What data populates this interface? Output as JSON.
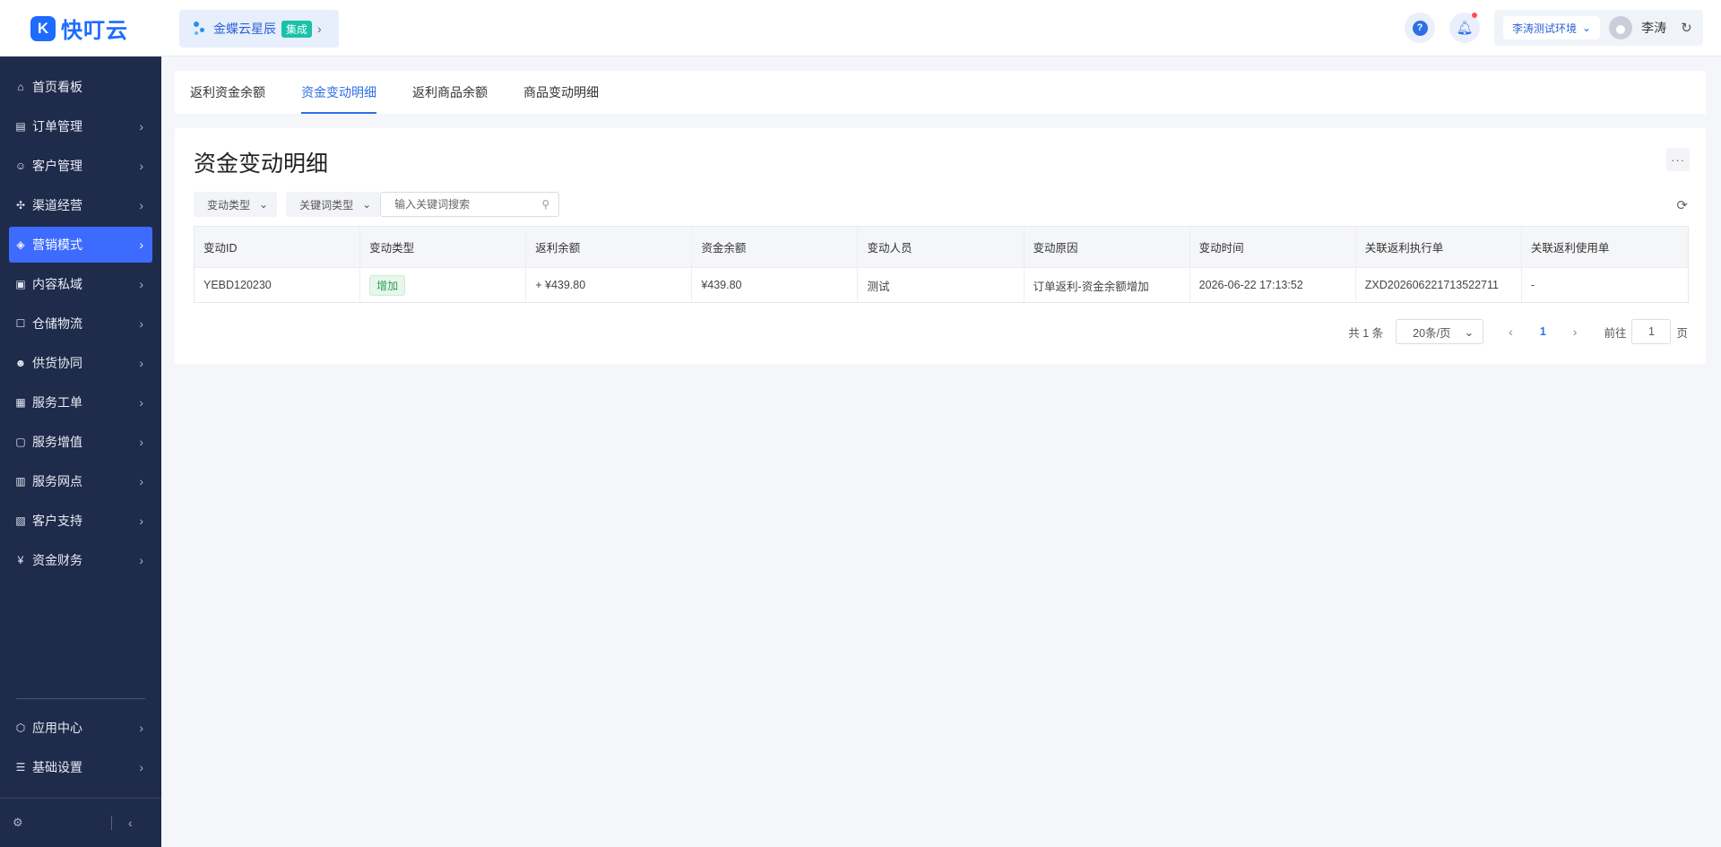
{
  "logo": {
    "mark": "K",
    "text": "快叮云"
  },
  "sidebar": {
    "items": [
      {
        "label": "首页看板",
        "icon": "home-icon",
        "has_arrow": false
      },
      {
        "label": "订单管理",
        "icon": "clipboard-icon",
        "has_arrow": true
      },
      {
        "label": "客户管理",
        "icon": "user-icon",
        "has_arrow": true
      },
      {
        "label": "渠道经营",
        "icon": "channel-icon",
        "has_arrow": true
      },
      {
        "label": "营销模式",
        "icon": "tag-icon",
        "has_arrow": true,
        "active": true
      },
      {
        "label": "内容私域",
        "icon": "image-icon",
        "has_arrow": true
      },
      {
        "label": "仓储物流",
        "icon": "box-icon",
        "has_arrow": true
      },
      {
        "label": "供货协同",
        "icon": "handshake-icon",
        "has_arrow": true
      },
      {
        "label": "服务工单",
        "icon": "ticket-icon",
        "has_arrow": true
      },
      {
        "label": "服务增值",
        "icon": "bag-icon",
        "has_arrow": true
      },
      {
        "label": "服务网点",
        "icon": "store-icon",
        "has_arrow": true
      },
      {
        "label": "客户支持",
        "icon": "support-icon",
        "has_arrow": true
      },
      {
        "label": "资金财务",
        "icon": "yen-icon",
        "has_arrow": true
      }
    ],
    "bottom_items": [
      {
        "label": "应用中心",
        "icon": "cube-icon"
      },
      {
        "label": "基础设置",
        "icon": "sliders-icon"
      }
    ]
  },
  "header": {
    "integration": {
      "name": "金蝶云星辰",
      "badge": "集成"
    },
    "env": "李涛测试环境",
    "user_name": "李涛"
  },
  "tabs": [
    {
      "label": "返利资金余额",
      "active": false
    },
    {
      "label": "资金变动明细",
      "active": true
    },
    {
      "label": "返利商品余额",
      "active": false
    },
    {
      "label": "商品变动明细",
      "active": false
    }
  ],
  "main": {
    "title": "资金变动明细",
    "filters": {
      "change_type": "变动类型",
      "keyword_type": "关键词类型",
      "search_placeholder": "输入关键词搜索"
    },
    "table": {
      "headers": [
        "变动ID",
        "变动类型",
        "返利余额",
        "资金余额",
        "变动人员",
        "变动原因",
        "变动时间",
        "关联返利执行单",
        "关联返利使用单"
      ],
      "rows": [
        {
          "id": "YEBD120230",
          "type": "增加",
          "rebate_balance": "+ ¥439.80",
          "fund_balance": "¥439.80",
          "operator": "测试",
          "reason": "订单返利-资金余额增加",
          "time": "2026-06-22 17:13:52",
          "exec_order": "ZXD202606221713522711",
          "use_order": "-"
        }
      ]
    },
    "pagination": {
      "total": "共 1 条",
      "page_size": "20条/页",
      "current": "1",
      "goto_label": "前往",
      "goto_value": "1",
      "page_suffix": "页"
    }
  },
  "colors": {
    "primary": "#2f6fe6",
    "sidebar": "#1f2b4b",
    "active_nav": "#3e6bff",
    "tag_green": "#2f9e55"
  }
}
